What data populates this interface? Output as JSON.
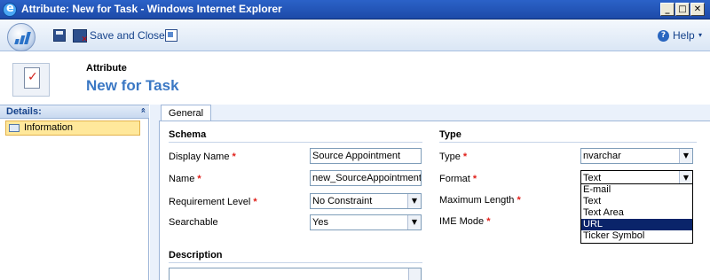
{
  "window": {
    "title": "Attribute: New for Task - Windows Internet Explorer",
    "min": "_",
    "max": "□",
    "close": "✕"
  },
  "toolbar": {
    "save_close_label": "Save and Close",
    "help_label": "Help",
    "help_caret": "▾"
  },
  "header": {
    "subtitle": "Attribute",
    "title": "New for Task"
  },
  "nav": {
    "heading": "Details:",
    "collapse": "«",
    "items": [
      {
        "label": "Information"
      }
    ]
  },
  "tabs": [
    {
      "label": "General"
    }
  ],
  "schema": {
    "heading": "Schema",
    "display_name": {
      "label": "Display Name",
      "value": "Source Appointment"
    },
    "name": {
      "label": "Name",
      "value": "new_SourceAppointment"
    },
    "requirement_level": {
      "label": "Requirement Level",
      "value": "No Constraint"
    },
    "searchable": {
      "label": "Searchable",
      "value": "Yes"
    }
  },
  "type_section": {
    "heading": "Type",
    "type": {
      "label": "Type",
      "value": "nvarchar"
    },
    "format": {
      "label": "Format",
      "value": "Text",
      "options": [
        "E-mail",
        "Text",
        "Text Area",
        "URL",
        "Ticker Symbol"
      ],
      "highlighted": "URL"
    },
    "max_length": {
      "label": "Maximum Length"
    },
    "ime_mode": {
      "label": "IME Mode"
    }
  },
  "description": {
    "heading": "Description"
  },
  "required_marker": "*",
  "select_arrow": "▼"
}
